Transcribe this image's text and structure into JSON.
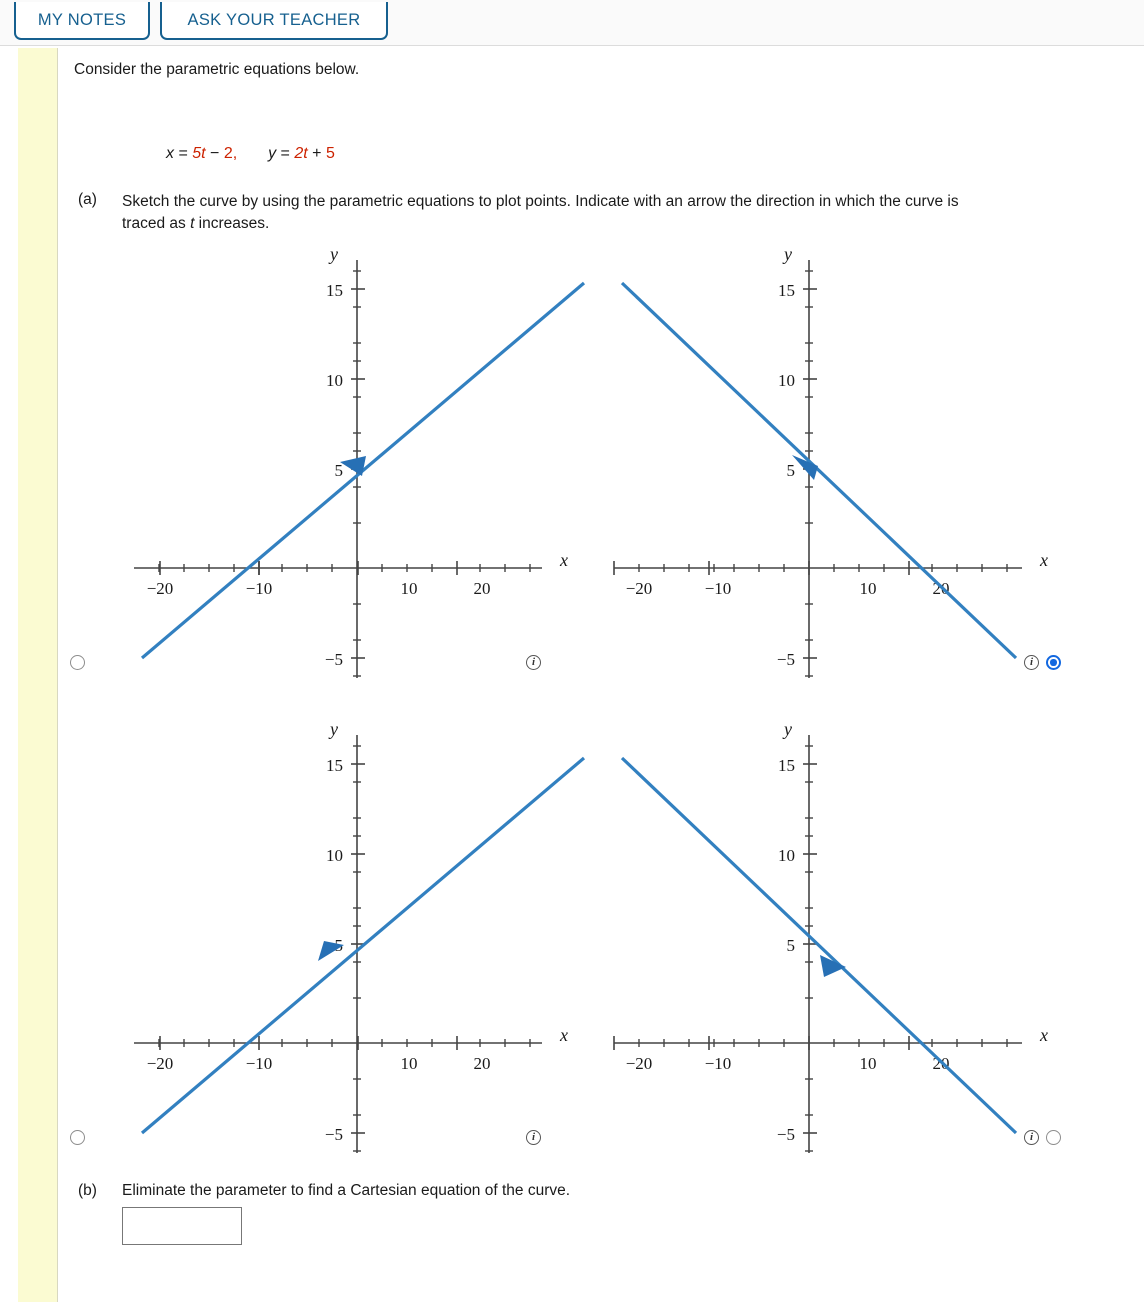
{
  "toolbar": {
    "my_notes_label": "MY NOTES",
    "ask_teacher_label": "ASK YOUR TEACHER",
    "border_color": "#16608f"
  },
  "question": {
    "intro": "Consider the parametric equations below.",
    "equation": {
      "x_var": "x",
      "x_eq": "=",
      "x_coef": "5t",
      "x_op": "−",
      "x_const": "2,",
      "y_var": "y",
      "y_eq": "=",
      "y_coef": "2t",
      "y_op": "+",
      "y_const": "5",
      "number_color": "#cc2200"
    },
    "part_a": {
      "label": "(a)",
      "text_1": "Sketch the curve by using the parametric equations to plot points. Indicate with an arrow the direction in which the curve is",
      "text_2a": "traced as ",
      "text_2b": "t",
      "text_2c": " increases."
    },
    "part_b": {
      "label": "(b)",
      "text": "Eliminate the parameter to find a Cartesian equation of the curve.",
      "answer_value": "",
      "answer_placeholder": ""
    }
  },
  "chart_data": [
    {
      "id": "graph-tl",
      "position": "top-left",
      "type": "line",
      "title": "",
      "xlabel": "x",
      "ylabel": "y",
      "xlim": [
        -27,
        27
      ],
      "ylim": [
        -6.5,
        16.5
      ],
      "x_ticks_major": [
        -20,
        -10,
        10,
        20
      ],
      "x_tick_labels": [
        "−20",
        "−10",
        "10",
        "20"
      ],
      "y_ticks_major": [
        -5,
        5,
        10,
        15
      ],
      "y_tick_labels": [
        "−5",
        "5",
        "10",
        "15"
      ],
      "minor_tick_step": 2.5,
      "grid": false,
      "legend": null,
      "series": [
        {
          "name": "line",
          "slope": 0.4,
          "intercept": 5.8,
          "x_start": -26,
          "x_end": 23,
          "color": "#3280c0"
        }
      ],
      "arrow": {
        "at_x": -1.5,
        "at_y": 5.2,
        "direction": "down-left",
        "label": "decreasing t"
      },
      "selected": false,
      "radio_side": "left",
      "info_side": "right"
    },
    {
      "id": "graph-tr",
      "position": "top-right",
      "type": "line",
      "title": "",
      "xlabel": "x",
      "ylabel": "y",
      "xlim": [
        -27,
        27
      ],
      "ylim": [
        -6.5,
        16.5
      ],
      "x_ticks_major": [
        -20,
        -10,
        10,
        20
      ],
      "x_tick_labels": [
        "−20",
        "−10",
        "10",
        "20"
      ],
      "y_ticks_major": [
        -5,
        5,
        10,
        15
      ],
      "y_tick_labels": [
        "−5",
        "5",
        "10",
        "15"
      ],
      "minor_tick_step": 2.5,
      "grid": false,
      "legend": null,
      "series": [
        {
          "name": "line",
          "slope": -0.4,
          "intercept": 5.8,
          "x_start": -23,
          "x_end": 26,
          "color": "#3280c0"
        }
      ],
      "arrow": {
        "at_x": -0.5,
        "at_y": 5.9,
        "direction": "up-left",
        "label": "decreasing t"
      },
      "selected": true,
      "radio_side": "right",
      "info_side": "right"
    },
    {
      "id": "graph-bl",
      "position": "bottom-left",
      "type": "line",
      "title": "",
      "xlabel": "x",
      "ylabel": "y",
      "xlim": [
        -27,
        27
      ],
      "ylim": [
        -6.5,
        16.5
      ],
      "x_ticks_major": [
        -20,
        -10,
        10,
        20
      ],
      "x_tick_labels": [
        "−20",
        "−10",
        "10",
        "20"
      ],
      "y_ticks_major": [
        -5,
        5,
        10,
        15
      ],
      "y_tick_labels": [
        "−5",
        "5",
        "10",
        "15"
      ],
      "minor_tick_step": 2.5,
      "grid": false,
      "legend": null,
      "series": [
        {
          "name": "line",
          "slope": 0.4,
          "intercept": 5.8,
          "x_start": -26,
          "x_end": 23,
          "color": "#3280c0"
        }
      ],
      "arrow": {
        "at_x": -3.5,
        "at_y": 4.4,
        "direction": "up-right",
        "label": "increasing t"
      },
      "selected": false,
      "radio_side": "left",
      "info_side": "right"
    },
    {
      "id": "graph-br",
      "position": "bottom-right",
      "type": "line",
      "title": "",
      "xlabel": "x",
      "ylabel": "y",
      "xlim": [
        -27,
        27
      ],
      "ylim": [
        -6.5,
        16.5
      ],
      "x_ticks_major": [
        -20,
        -10,
        10,
        20
      ],
      "x_tick_labels": [
        "−20",
        "−10",
        "10",
        "20"
      ],
      "y_ticks_major": [
        -5,
        5,
        10,
        15
      ],
      "y_tick_labels": [
        "−5",
        "5",
        "10",
        "15"
      ],
      "minor_tick_step": 2.5,
      "grid": false,
      "legend": null,
      "series": [
        {
          "name": "line",
          "slope": -0.4,
          "intercept": 5.8,
          "x_start": -23,
          "x_end": 26,
          "color": "#3280c0"
        }
      ],
      "arrow": {
        "at_x": 3.0,
        "at_y": 4.6,
        "direction": "down-left",
        "label": "decreasing t"
      },
      "selected": false,
      "radio_side": "right",
      "info_side": "right"
    }
  ],
  "icons": {
    "info_glyph": "i"
  }
}
